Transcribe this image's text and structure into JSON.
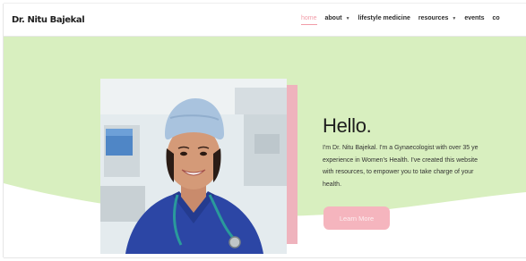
{
  "header": {
    "brand": "Dr. Nitu Bajekal",
    "nav": [
      {
        "label": "home",
        "has_dropdown": false,
        "active": true
      },
      {
        "label": "about",
        "has_dropdown": true,
        "active": false
      },
      {
        "label": "lifestyle medicine",
        "has_dropdown": false,
        "active": false
      },
      {
        "label": "resources",
        "has_dropdown": true,
        "active": false
      },
      {
        "label": "events",
        "has_dropdown": false,
        "active": false
      },
      {
        "label": "co",
        "has_dropdown": false,
        "active": false
      }
    ],
    "dropdown_glyph": "▼"
  },
  "hero": {
    "title": "Hello.",
    "body_lines": [
      "I'm Dr. Nitu Bajekal. I'm a Gynaecologist with over 35 ye",
      "experience in Women's Health. I've created this website",
      "with resources, to empower you to take charge of your",
      "health."
    ],
    "button_label": "Learn More"
  },
  "colors": {
    "hero_green": "#d8efbf",
    "accent_pink": "#efb3bd",
    "active_nav": "#f19ca8",
    "button_pink": "#f5b5be"
  }
}
